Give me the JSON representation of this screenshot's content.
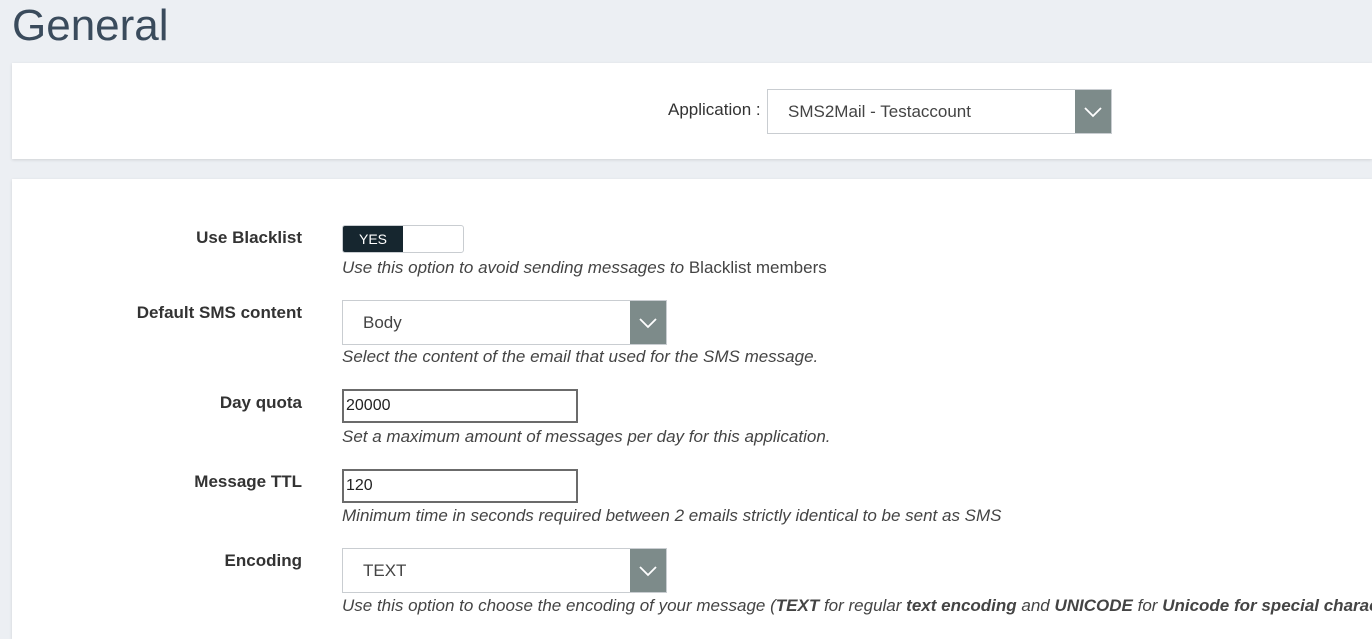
{
  "page": {
    "title": "General"
  },
  "application": {
    "label": "Application :",
    "selected": "SMS2Mail - Testaccount"
  },
  "form": {
    "blacklist": {
      "label": "Use Blacklist",
      "toggle_value": "YES",
      "help_italic": "Use this option to avoid sending messages to ",
      "help_plain": "Blacklist members"
    },
    "sms_content": {
      "label": "Default SMS content",
      "selected": "Body",
      "help": "Select the content of the email that used for the SMS message."
    },
    "day_quota": {
      "label": "Day quota",
      "value": "20000",
      "help": "Set a maximum amount of messages per day for this application."
    },
    "message_ttl": {
      "label": "Message TTL",
      "value": "120",
      "help": "Minimum time in seconds required between 2 emails strictly identical to be sent as SMS"
    },
    "encoding": {
      "label": "Encoding",
      "selected": "TEXT",
      "help_1": "Use this option to choose the encoding of your message (",
      "help_2": "TEXT",
      "help_3": " for regular ",
      "help_4": "text encoding",
      "help_5": " and ",
      "help_6": "UNICODE",
      "help_7": " for ",
      "help_8": "Unicode for special characters",
      "help_9": ")."
    }
  },
  "colors": {
    "background": "#eceff3",
    "caret_bg": "#7d8b8a",
    "toggle_on": "#16262f",
    "title": "#3a4b5c"
  },
  "icons": {
    "dropdown": "chevron-down-icon"
  }
}
